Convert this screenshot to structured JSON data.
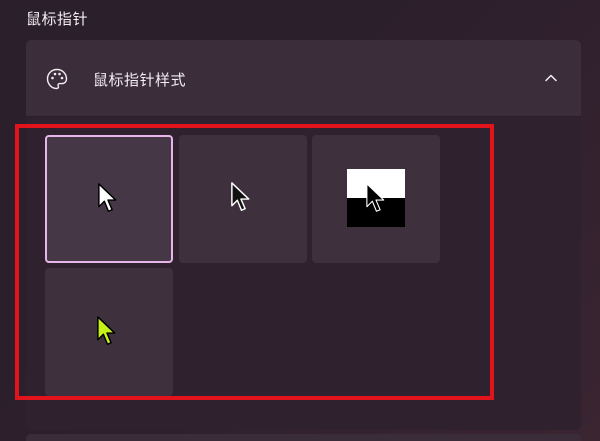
{
  "section": {
    "title": "鼠标指针"
  },
  "card": {
    "header_label": "鼠标指针样式",
    "header_icon": "palette-icon",
    "expanded_icon": "chevron-up-icon"
  },
  "styles": [
    {
      "id": "white",
      "icon": "white-cursor-icon",
      "selected": true
    },
    {
      "id": "black",
      "icon": "black-cursor-icon",
      "selected": false
    },
    {
      "id": "inverted",
      "icon": "inverted-cursor-icon",
      "selected": false
    },
    {
      "id": "custom",
      "icon": "lime-cursor-icon",
      "selected": false,
      "color": "#c6f21a"
    }
  ],
  "colors": {
    "selected_border": "#e6b6ea",
    "highlight_frame": "#e0141a"
  }
}
